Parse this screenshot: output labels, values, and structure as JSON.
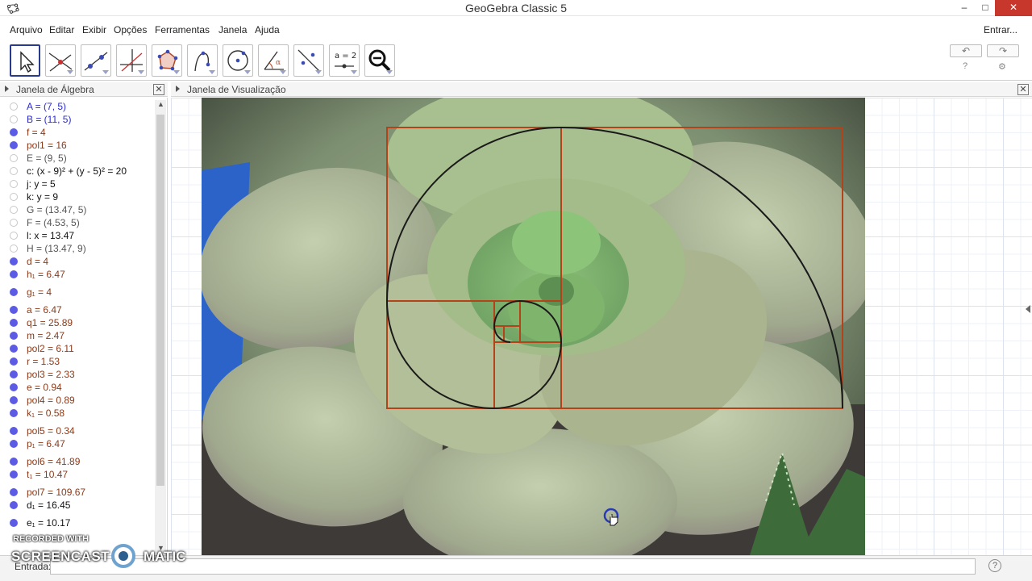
{
  "window": {
    "title": "GeoGebra Classic 5",
    "minimize": "–",
    "maximize": "□",
    "close": "✕"
  },
  "menubar": {
    "items": [
      "Arquivo",
      "Editar",
      "Exibir",
      "Opções",
      "Ferramentas",
      "Janela",
      "Ajuda"
    ],
    "signin": "Entrar..."
  },
  "toolbar": {
    "tools": [
      {
        "name": "move-tool-icon",
        "selected": true
      },
      {
        "name": "point-tool-icon",
        "selected": false
      },
      {
        "name": "line-tool-icon",
        "selected": false
      },
      {
        "name": "perpendicular-line-tool-icon",
        "selected": false
      },
      {
        "name": "polygon-tool-icon",
        "selected": false
      },
      {
        "name": "curve-tool-icon",
        "selected": false
      },
      {
        "name": "circle-tool-icon",
        "selected": false
      },
      {
        "name": "angle-tool-icon",
        "selected": false
      },
      {
        "name": "reflect-tool-icon",
        "selected": false
      },
      {
        "name": "slider-tool-icon",
        "selected": false,
        "label": "a = 2"
      },
      {
        "name": "zoom-tool-icon",
        "selected": false
      }
    ],
    "undo": "↶",
    "redo": "↷",
    "help": "?",
    "settings": "⚙"
  },
  "algebra": {
    "title": "Janela de Álgebra",
    "rows": [
      {
        "text": "A = (7, 5)",
        "shown": false,
        "color": "#2a2ad0"
      },
      {
        "text": "B = (11, 5)",
        "shown": false,
        "color": "#2a2ad0"
      },
      {
        "text": "f = 4",
        "shown": true,
        "color": "#8b3a1a"
      },
      {
        "text": "pol1 = 16",
        "shown": true,
        "color": "#8b3a1a"
      },
      {
        "text": "E = (9, 5)",
        "shown": false,
        "color": "#555555"
      },
      {
        "text": "c: (x - 9)² + (y - 5)² = 20",
        "shown": false,
        "color": "#111111"
      },
      {
        "text": "j: y = 5",
        "shown": false,
        "color": "#111111"
      },
      {
        "text": "k: y = 9",
        "shown": false,
        "color": "#111111"
      },
      {
        "text": "G = (13.47, 5)",
        "shown": false,
        "color": "#555555"
      },
      {
        "text": "F = (4.53, 5)",
        "shown": false,
        "color": "#555555"
      },
      {
        "text": "l: x = 13.47",
        "shown": false,
        "color": "#111111"
      },
      {
        "text": "H = (13.47, 9)",
        "shown": false,
        "color": "#555555"
      },
      {
        "text": "d = 4",
        "shown": true,
        "color": "#8b3a1a"
      },
      {
        "text": "h₁ = 6.47",
        "shown": true,
        "color": "#8b3a1a"
      },
      {
        "text": "g₁ = 4",
        "shown": true,
        "color": "#8b3a1a"
      },
      {
        "text": "a = 6.47",
        "shown": true,
        "color": "#8b3a1a"
      },
      {
        "text": "q1 = 25.89",
        "shown": true,
        "color": "#8b3a1a"
      },
      {
        "text": "m = 2.47",
        "shown": true,
        "color": "#8b3a1a"
      },
      {
        "text": "pol2 = 6.11",
        "shown": true,
        "color": "#8b3a1a"
      },
      {
        "text": "r = 1.53",
        "shown": true,
        "color": "#8b3a1a"
      },
      {
        "text": "pol3 = 2.33",
        "shown": true,
        "color": "#8b3a1a"
      },
      {
        "text": "e = 0.94",
        "shown": true,
        "color": "#8b3a1a"
      },
      {
        "text": "pol4 = 0.89",
        "shown": true,
        "color": "#8b3a1a"
      },
      {
        "text": "k₁ = 0.58",
        "shown": true,
        "color": "#8b3a1a"
      },
      {
        "text": "pol5 = 0.34",
        "shown": true,
        "color": "#8b3a1a"
      },
      {
        "text": "p₁ = 6.47",
        "shown": true,
        "color": "#8b3a1a"
      },
      {
        "text": "pol6 = 41.89",
        "shown": true,
        "color": "#8b3a1a"
      },
      {
        "text": "t₁ = 10.47",
        "shown": true,
        "color": "#8b3a1a"
      },
      {
        "text": "pol7 = 109.67",
        "shown": true,
        "color": "#8b3a1a"
      },
      {
        "text": "d₁ = 16.45",
        "shown": true,
        "color": "#111111"
      },
      {
        "text": "e₁ = 10.17",
        "shown": true,
        "color": "#111111"
      }
    ]
  },
  "graphics": {
    "title": "Janela de Visualização"
  },
  "inputbar": {
    "label": "Entrada:",
    "help": "?"
  },
  "watermark": {
    "line1": "RECORDED WITH",
    "brand_left": "SCREENCAST",
    "brand_right": "MATIC"
  }
}
